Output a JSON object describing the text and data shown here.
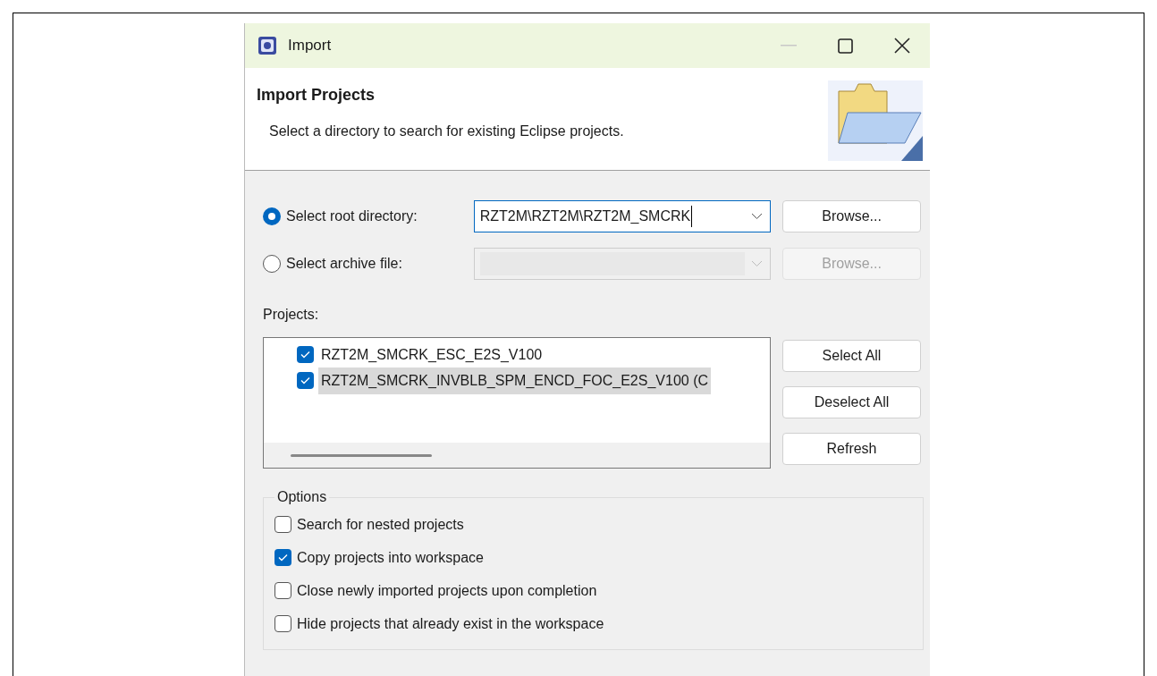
{
  "window": {
    "title": "Import"
  },
  "header": {
    "title": "Import Projects",
    "description": "Select a directory to search for existing Eclipse projects."
  },
  "sources": [
    {
      "label": "Select root directory:",
      "selected": true,
      "disabled": false,
      "value": "RZT2M\\RZT2M\\RZT2M_SMCRK",
      "button": "Browse..."
    },
    {
      "label": "Select archive file:",
      "selected": false,
      "disabled": true,
      "button": "Browse..."
    }
  ],
  "projects": {
    "label": "Projects:",
    "items": [
      {
        "name": "RZT2M_SMCRK_ESC_E2S_V100",
        "checked": true,
        "selected": false
      },
      {
        "name": "RZT2M_SMCRK_INVBLB_SPM_ENCD_FOC_E2S_V100 (C",
        "checked": true,
        "selected": true
      }
    ],
    "buttons": [
      "Select All",
      "Deselect All",
      "Refresh"
    ]
  },
  "options": {
    "title": "Options",
    "items": [
      {
        "label": "Search for nested projects",
        "checked": false
      },
      {
        "label": "Copy projects into workspace",
        "checked": true
      },
      {
        "label": "Close newly imported projects upon completion",
        "checked": false
      },
      {
        "label": "Hide projects that already exist in the workspace",
        "checked": false
      }
    ]
  }
}
